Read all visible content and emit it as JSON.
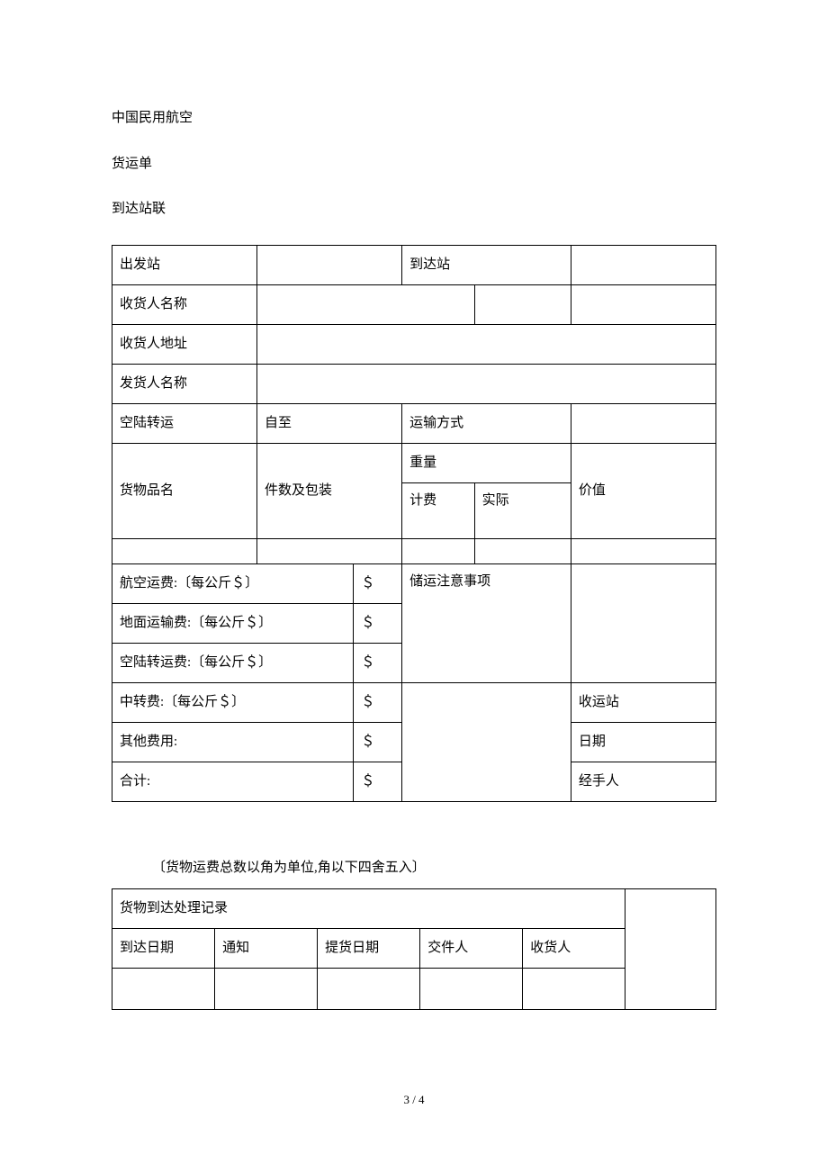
{
  "header": {
    "org": "中国民用航空",
    "title": "货运单",
    "copy": "到达站联"
  },
  "main": {
    "depart_station_label": "出发站",
    "arrive_station_label": "到达站",
    "consignee_name_label": "收货人名称",
    "consignee_addr_label": "收货人地址",
    "shipper_name_label": "发货人名称",
    "air_land_transfer_label": "空陆转运",
    "from_to": "自至",
    "transport_mode_label": "运输方式",
    "goods_name_label": "货物品名",
    "pieces_pack_label": "件数及包装",
    "weight_label": "重量",
    "weight_charge_label": "计费",
    "weight_actual_label": "实际",
    "value_label": "价值"
  },
  "fees": {
    "items": [
      {
        "label": "航空运费:〔每公斤＄〕",
        "val": "＄"
      },
      {
        "label": "地面运输费:〔每公斤＄〕",
        "val": "＄"
      },
      {
        "label": "空陆转运费:〔每公斤＄〕",
        "val": "＄"
      },
      {
        "label": "中转费:〔每公斤＄〕",
        "val": "＄"
      },
      {
        "label": "其他费用:",
        "val": "＄"
      },
      {
        "label": "合计:",
        "val": "＄"
      }
    ],
    "storage_notice_label": "储运注意事项",
    "receive_station_label": "收运站",
    "date_label": "日期",
    "handler_label": "经手人"
  },
  "note": "〔货物运费总数以角为单位,角以下四舍五入〕",
  "arrival": {
    "title": "货物到达处理记录",
    "cols": {
      "arrive_date": "到达日期",
      "notify": "通知",
      "pickup_date": "提货日期",
      "deliverer": "交件人",
      "consignee": "收货人"
    }
  },
  "page": "3 / 4"
}
